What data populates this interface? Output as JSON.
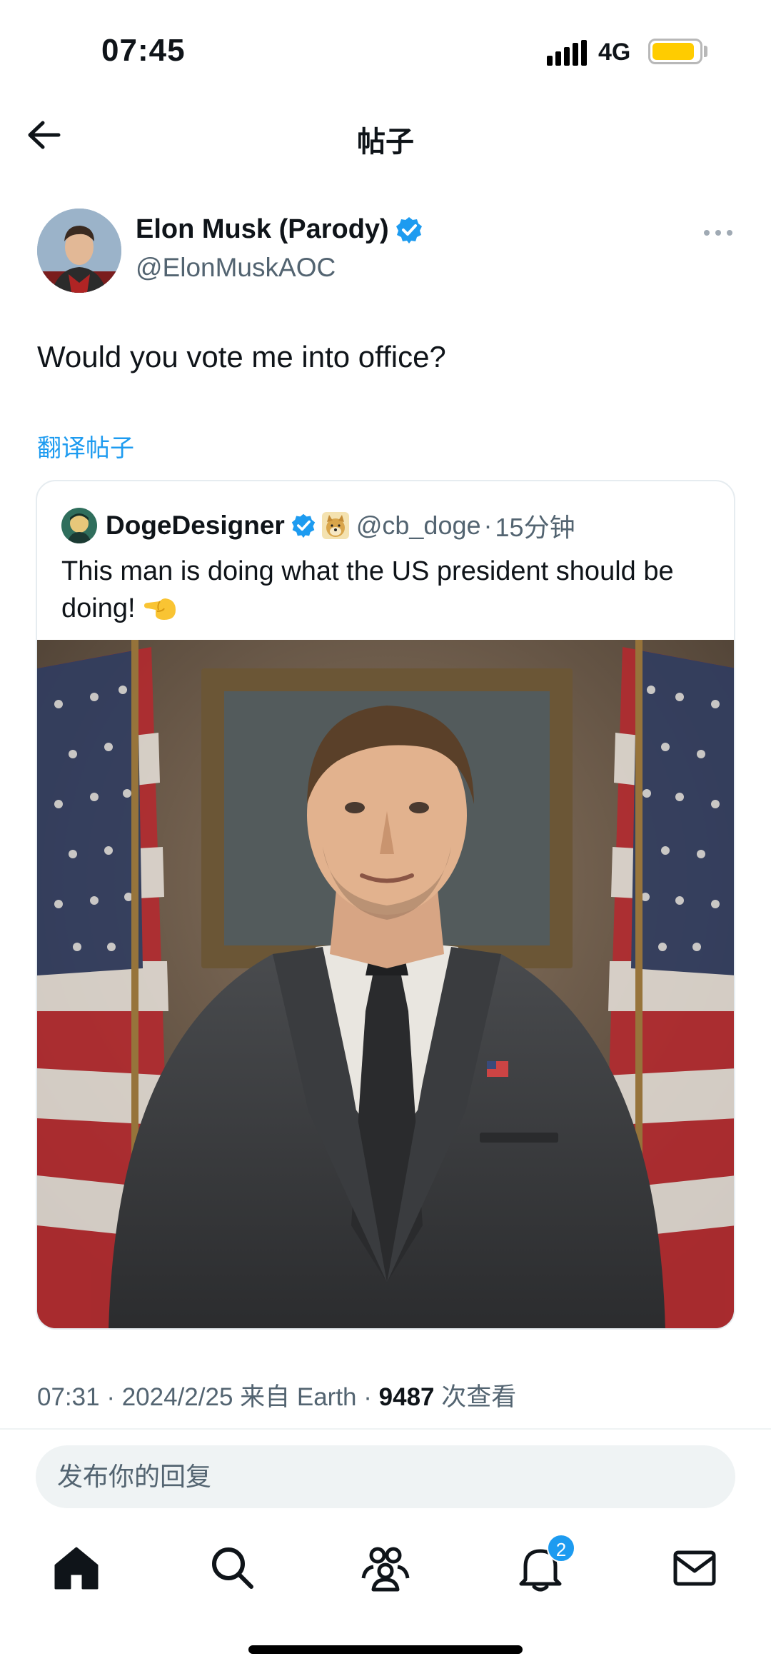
{
  "status_bar": {
    "time": "07:45",
    "network": "4G",
    "battery_level": 0.9,
    "battery_color": "#ffcc00"
  },
  "header": {
    "title": "帖子",
    "back_icon": "arrow-left-icon"
  },
  "post": {
    "author_name": "Elon Musk (Parody)",
    "author_handle": "@ElonMuskAOC",
    "verified": true,
    "text": "Would you vote me into office?",
    "translate_label": "翻译帖子",
    "quote": {
      "author_name": "DogeDesigner",
      "author_handle": "@cb_doge",
      "separator": "·",
      "time": "15分钟",
      "text": "This man is doing what the US president should be doing!",
      "emoji": "pointing-hand-emoji"
    },
    "meta": {
      "time": "07:31",
      "sep1": " · ",
      "date": "2024/2/25",
      "source": " 来自 Earth",
      "sep2": " · ",
      "views": "9487",
      "views_label": " 次查看"
    }
  },
  "reply": {
    "placeholder": "发布你的回复"
  },
  "tab_bar": {
    "items": [
      "home-icon",
      "search-icon",
      "communities-icon",
      "notifications-icon",
      "messages-icon"
    ],
    "notification_count": "2"
  },
  "colors": {
    "accent": "#1d9bf0",
    "text_primary": "#0f1419",
    "text_secondary": "#536471"
  }
}
